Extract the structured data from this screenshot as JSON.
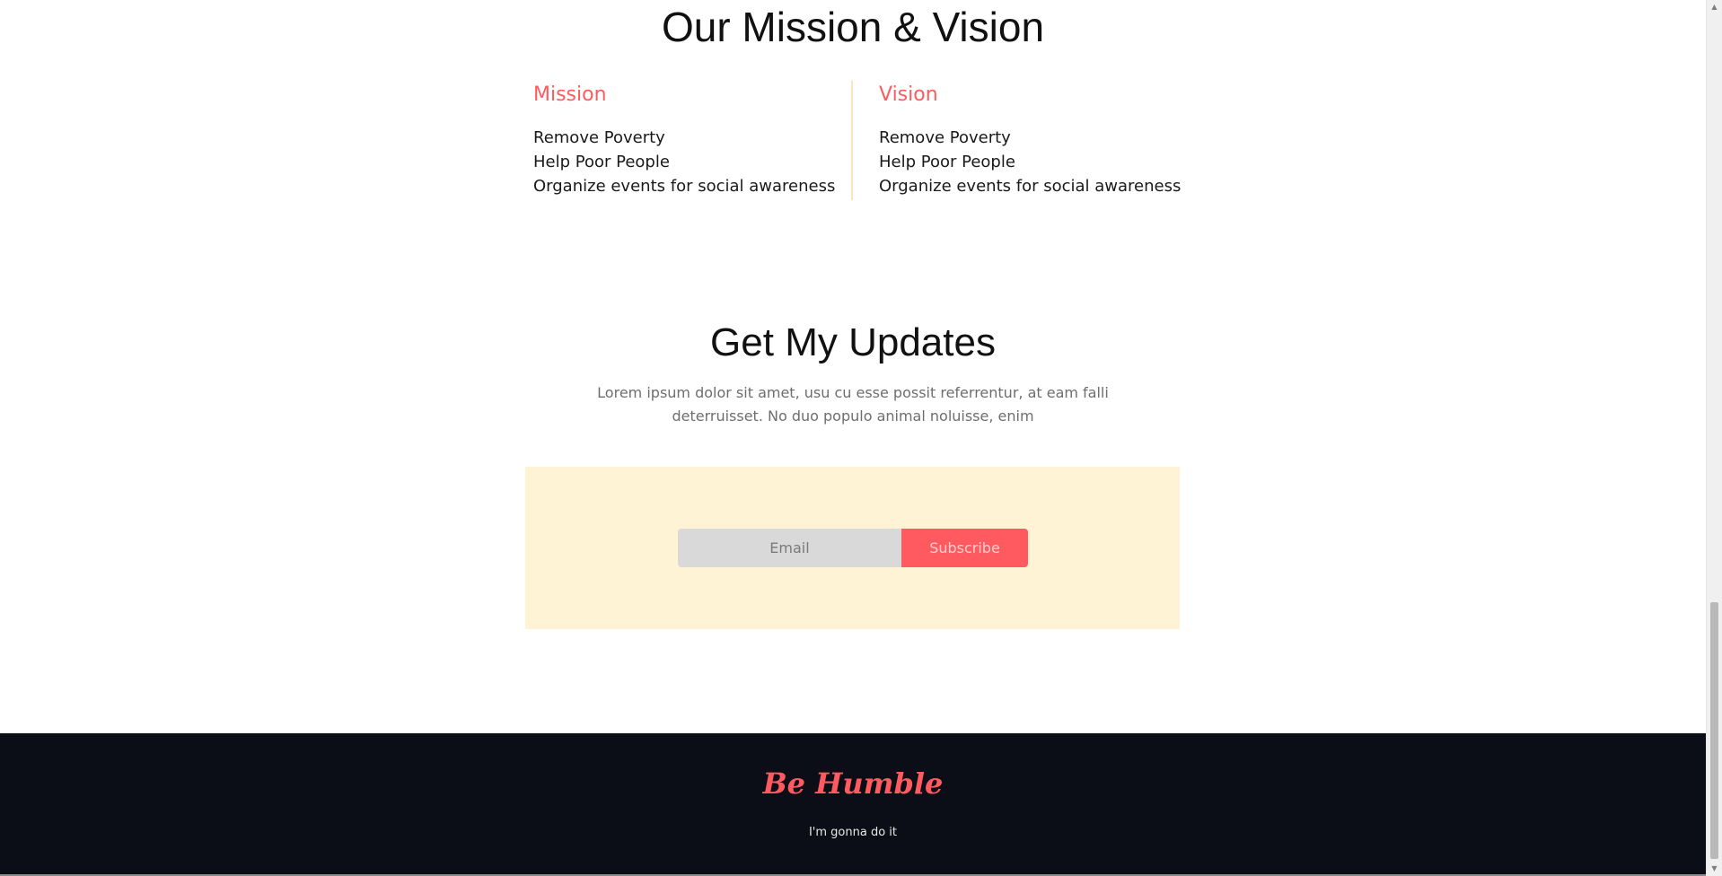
{
  "mission_vision": {
    "title": "Our Mission & Vision",
    "mission": {
      "heading": "Mission",
      "items": [
        "Remove Poverty",
        "Help Poor People",
        "Organize events for social awareness"
      ]
    },
    "vision": {
      "heading": "Vision",
      "items": [
        "Remove Poverty",
        "Help Poor People",
        "Organize events for social awareness"
      ]
    }
  },
  "updates": {
    "title": "Get My Updates",
    "description": "Lorem ipsum dolor sit amet, usu cu esse possit referrentur, at eam falli deterruisset. No duo populo animal noluisse, enim",
    "email_placeholder": "Email",
    "subscribe_label": "Subscribe"
  },
  "footer": {
    "brand": "Be Humble",
    "tagline": "I'm gonna do it"
  },
  "colors": {
    "accent": "#ff5a5f",
    "subscribe_bg": "#fff3d6",
    "footer_bg": "#0c0e17",
    "divider": "#fbe5bf"
  },
  "icons": {
    "scroll_up": "scroll-up-arrow-icon",
    "scroll_down": "scroll-down-arrow-icon"
  }
}
